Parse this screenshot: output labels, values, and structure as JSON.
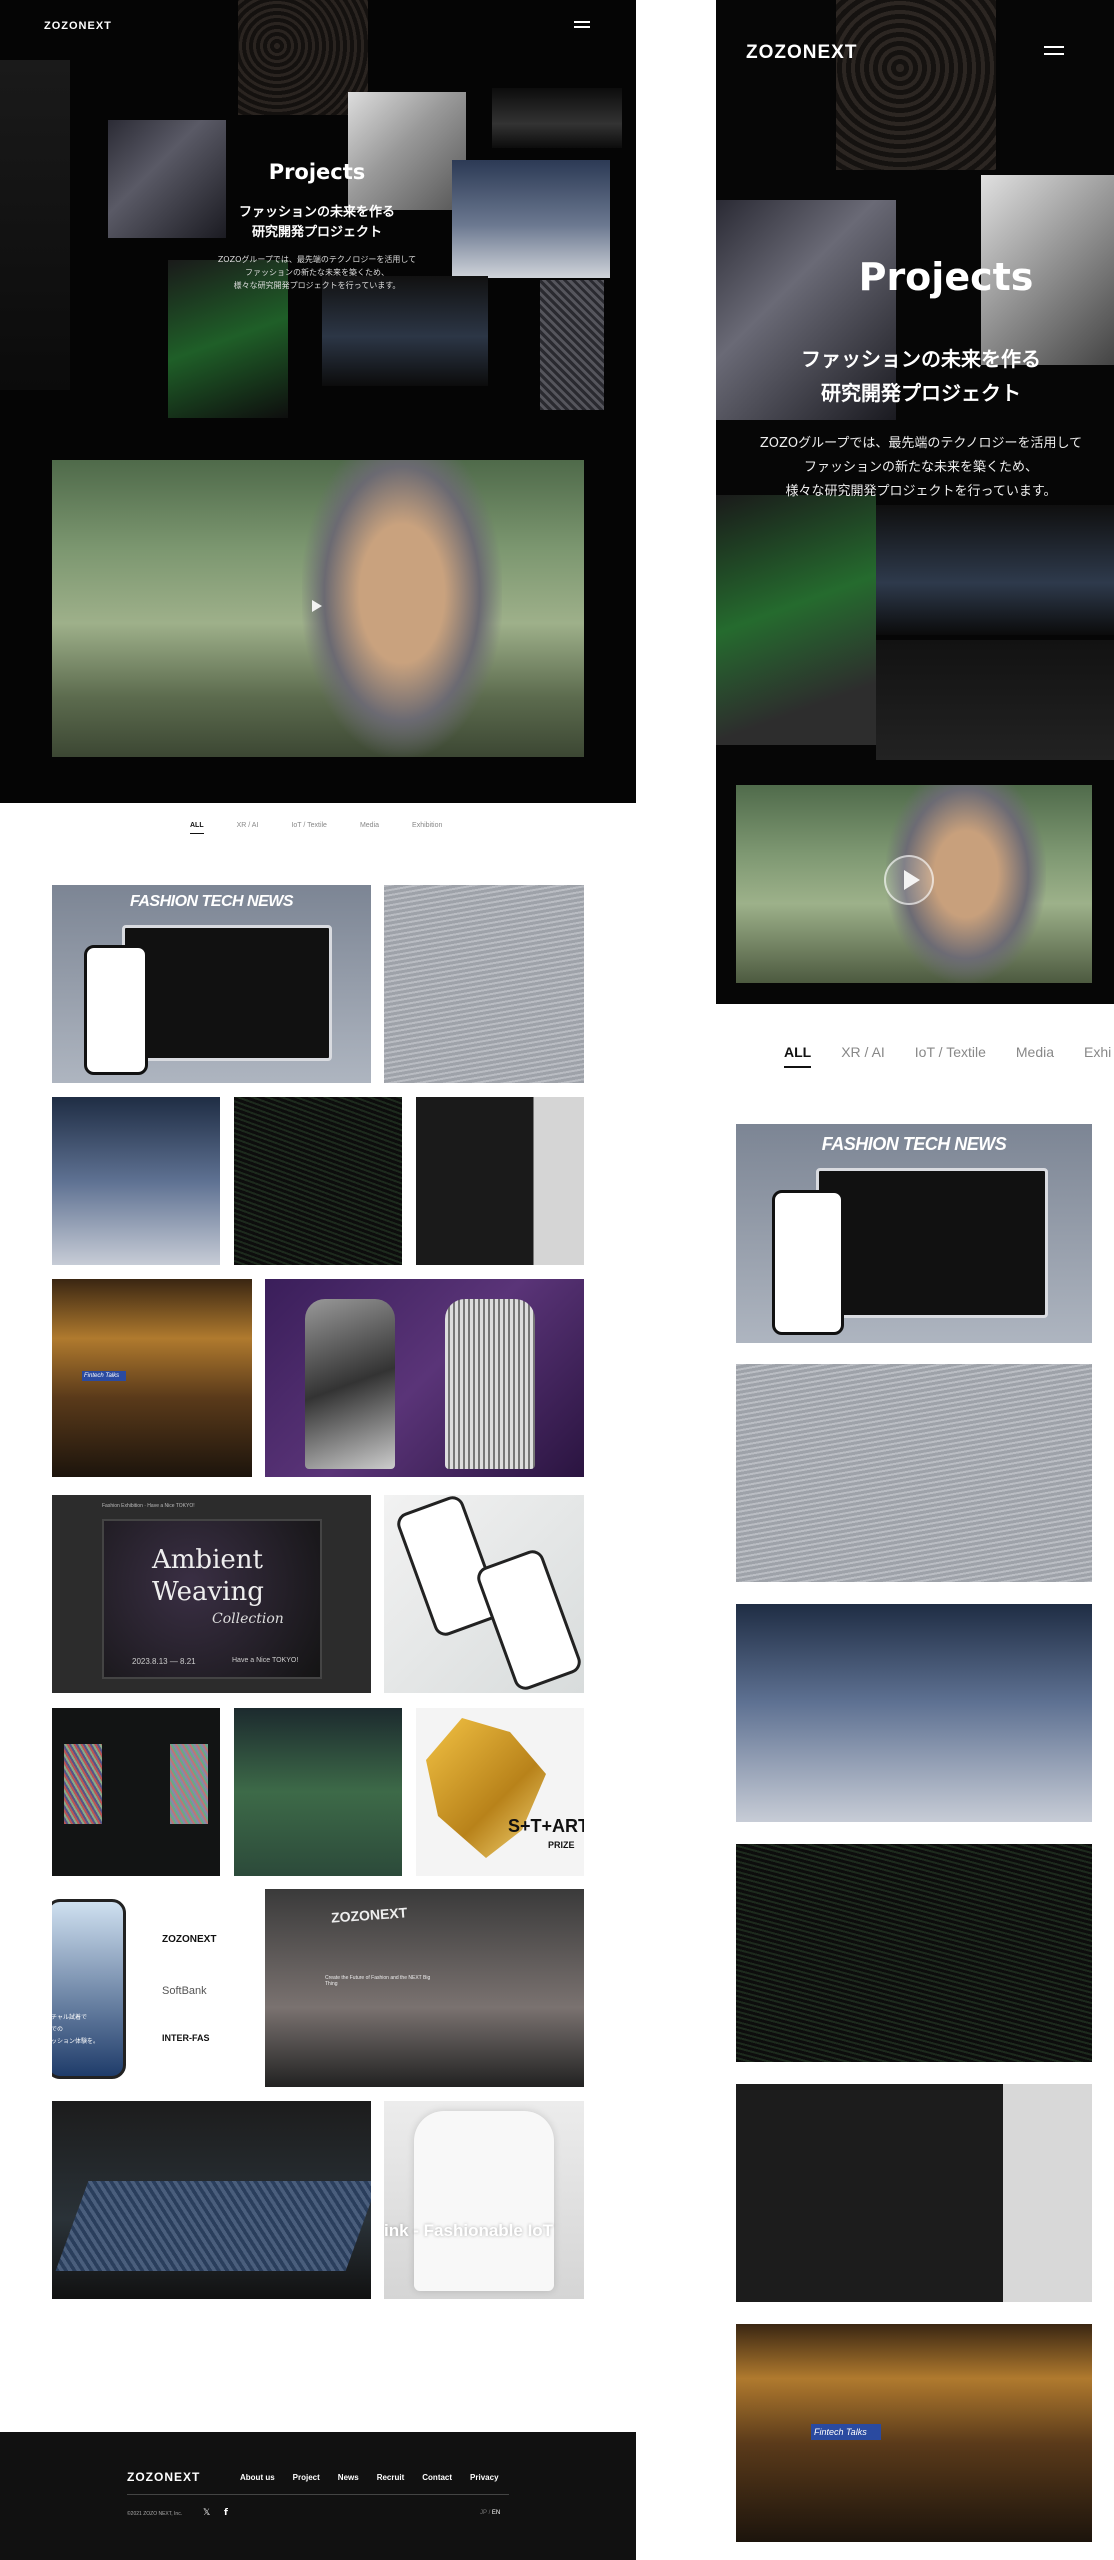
{
  "brand": {
    "logo": "ZOZONEXT"
  },
  "hero": {
    "title": "Projects",
    "subtitle_line1": "ファッションの未来を作る",
    "subtitle_line2": "研究開発プロジェクト",
    "desc_line1": "ZOZOグループでは、最先端のテクノロジーを活用して",
    "desc_line2": "ファッションの新たな未来を築くため、",
    "desc_line3": "様々な研究開発プロジェクトを行っています。"
  },
  "filters": [
    "ALL",
    "XR / AI",
    "IoT / Textile",
    "Media",
    "Exhibition"
  ],
  "mobile_filters": [
    "ALL",
    "XR / AI",
    "IoT / Textile",
    "Media",
    "Exhi"
  ],
  "cards": {
    "ftn_title": "FASHION TECH NEWS",
    "ambient_line1": "Ambient",
    "ambient_line2": "Weaving",
    "ambient_line3": "Collection",
    "ambient_date": "2023.8.13 — 8.21",
    "ambient_tag": "Have a Nice TOKYO!",
    "ambient_top": "Fashion Exhibition · Have a Nice TOKYO!",
    "fintech_label": "Fintech Talks",
    "start_label": "S+T+ART",
    "start_sub": "PRIZE",
    "partner1": "ZOZONEXT",
    "partner2": "SoftBank",
    "partner3": "INTER-FAS",
    "phone_jp1": "チャル試着で",
    "phone_jp2": "での",
    "phone_jp3": "ッション体験を。",
    "booth_logo": "ZOZONEXT",
    "booth_text": "Create the Future of Fashion and the NEXT Big Thing",
    "fashionable_iot": "ink - Fashionable IoT"
  },
  "footer": {
    "logo": "ZOZONEXT",
    "nav": [
      "About us",
      "Project",
      "News",
      "Recruit",
      "Contact",
      "Privacy"
    ],
    "copyright": "©2021 ZOZO NEXT, Inc.",
    "x_icon": "𝕏",
    "facebook_icon": "f",
    "lang_jp": "JP",
    "lang_sep": "/",
    "lang_en": "EN"
  },
  "colors": {
    "hero_bg": "#050505",
    "footer_bg": "#111111",
    "accent_green": "#2f7a35",
    "accent_purple": "#3a1e5a"
  }
}
